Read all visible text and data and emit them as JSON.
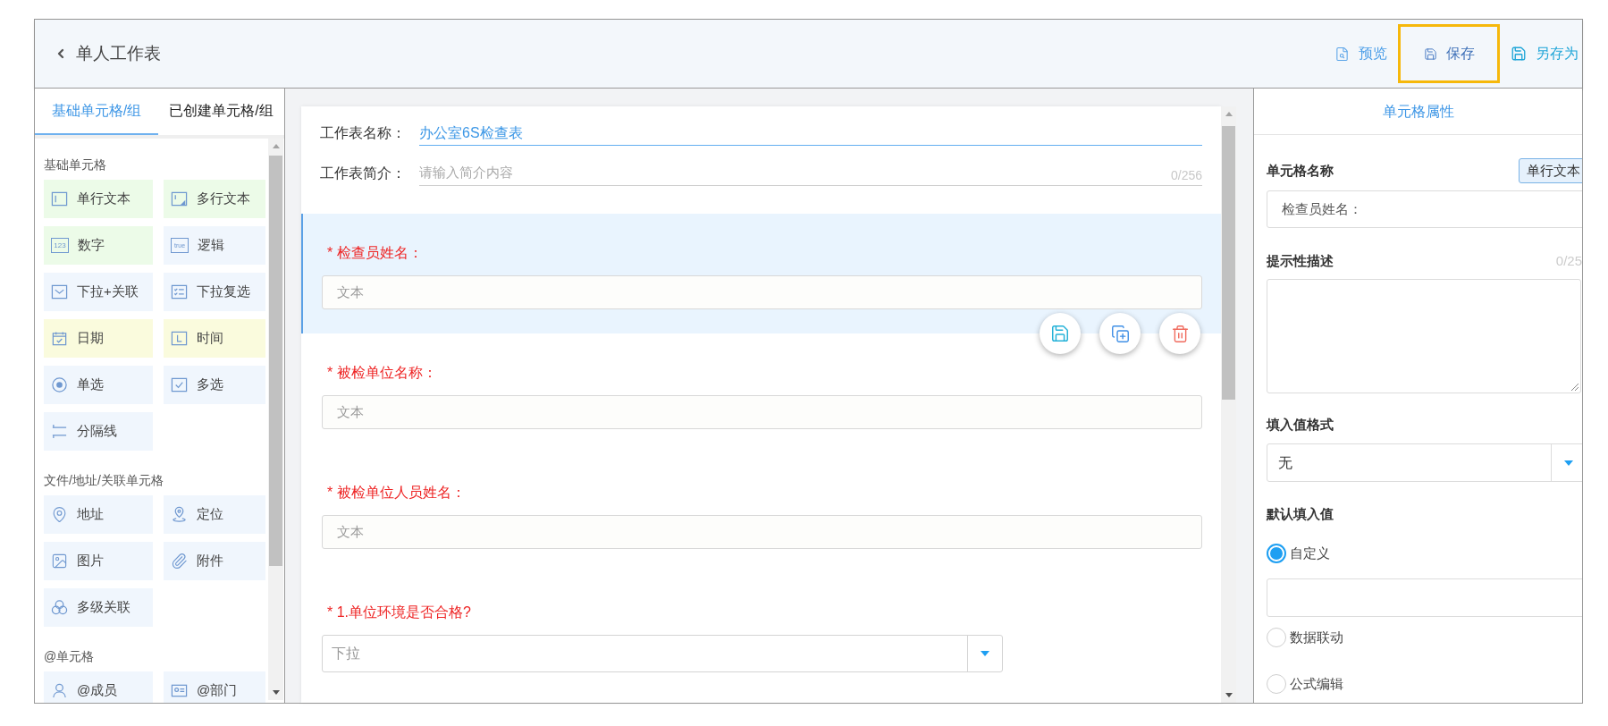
{
  "header": {
    "title": "单人工作表",
    "actions": [
      {
        "kind": "preview",
        "label": "预览",
        "highlighted": false
      },
      {
        "kind": "save",
        "label": "保存",
        "highlighted": true
      },
      {
        "kind": "save_as",
        "label": "另存为",
        "highlighted": false
      }
    ]
  },
  "palette": {
    "tabs": [
      {
        "label": "基础单元格/组",
        "selected": true
      },
      {
        "label": "已创建单元格/组",
        "selected": false
      }
    ],
    "sections": [
      {
        "title": "基础单元格",
        "items": [
          {
            "kind": "single_line",
            "label": "单行文本",
            "color": "#ecfbe8"
          },
          {
            "kind": "multi_line",
            "label": "多行文本",
            "color": "#ecfbe8"
          },
          {
            "kind": "number",
            "label": "数字",
            "icon_text": "123",
            "color": "#ecfbe8"
          },
          {
            "kind": "logic",
            "label": "逻辑",
            "icon_text": "true",
            "color": "#f0f6fd"
          },
          {
            "kind": "dropdown_link",
            "label": "下拉+关联",
            "color": "#f0f6fd"
          },
          {
            "kind": "dropdown_multi",
            "label": "下拉复选",
            "color": "#f0f6fd"
          },
          {
            "kind": "date",
            "label": "日期",
            "color": "#fafbdd"
          },
          {
            "kind": "time",
            "label": "时间",
            "color": "#fafbdd"
          },
          {
            "kind": "radio",
            "label": "单选",
            "color": "#f0f6fd"
          },
          {
            "kind": "checkbox",
            "label": "多选",
            "color": "#f0f6fd"
          },
          {
            "kind": "divider",
            "label": "分隔线",
            "color": "#f0f6fd"
          }
        ]
      },
      {
        "title": "文件/地址/关联单元格",
        "items": [
          {
            "kind": "address",
            "label": "地址",
            "color": "#f0f6fd"
          },
          {
            "kind": "location",
            "label": "定位",
            "color": "#f0f6fd"
          },
          {
            "kind": "image",
            "label": "图片",
            "color": "#f0f6fd"
          },
          {
            "kind": "attachment",
            "label": "附件",
            "color": "#f0f6fd"
          },
          {
            "kind": "cascade",
            "label": "多级关联",
            "color": "#f0f6fd"
          }
        ]
      },
      {
        "title": "@单元格",
        "items": [
          {
            "kind": "member",
            "label": "@成员",
            "color": "#f0f6fd"
          },
          {
            "kind": "department",
            "label": "@部门",
            "color": "#f0f6fd"
          }
        ]
      }
    ]
  },
  "form": {
    "name": {
      "label": "工作表名称：",
      "value": "办公室6S检查表"
    },
    "intro": {
      "label": "工作表简介：",
      "placeholder": "请输入简介内容",
      "counter": "0/256"
    },
    "fields": [
      {
        "kind": "text",
        "label": "* 检查员姓名：",
        "placeholder": "文本",
        "selected": true
      },
      {
        "kind": "text",
        "label": "* 被检单位名称：",
        "placeholder": "文本",
        "selected": false
      },
      {
        "kind": "text",
        "label": "* 被检单位人员姓名：",
        "placeholder": "文本",
        "selected": false
      },
      {
        "kind": "dropdown",
        "label": "* 1.单位环境是否合格?",
        "placeholder": "下拉",
        "selected": false
      }
    ]
  },
  "properties": {
    "title": "单元格属性",
    "cell_name": {
      "label": "单元格名称",
      "type_badge": "单行文本",
      "value": "检查员姓名："
    },
    "hint": {
      "label": "提示性描述",
      "counter": "0/25"
    },
    "value_format": {
      "label": "填入值格式",
      "value": "无"
    },
    "default_value": {
      "label": "默认填入值",
      "options": [
        {
          "label": "自定义",
          "selected": true
        },
        {
          "label": "数据联动",
          "selected": false
        },
        {
          "label": "公式编辑",
          "selected": false
        }
      ]
    }
  }
}
